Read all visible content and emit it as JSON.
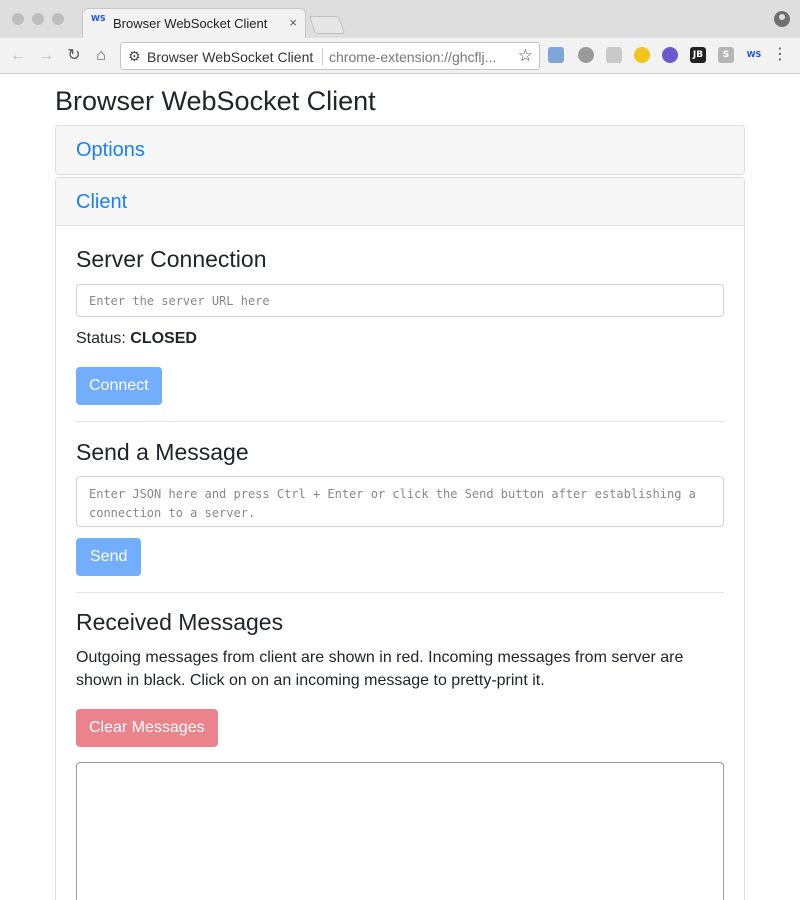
{
  "browser": {
    "tab_title": "Browser WebSocket Client",
    "tab_favicon_text": "WS",
    "close_glyph": "×",
    "omnibox_title": "Browser WebSocket Client",
    "omnibox_url": "chrome-extension://ghcflj...",
    "extension_labels": {
      "jb": "JB",
      "s": "S",
      "ws": "WS"
    }
  },
  "page": {
    "title": "Browser WebSocket Client",
    "options_header": "Options",
    "client_header": "Client"
  },
  "server_connection": {
    "heading": "Server Connection",
    "url_placeholder": "Enter the server URL here",
    "status_label": "Status:",
    "status_value": "CLOSED",
    "connect_label": "Connect"
  },
  "send_message": {
    "heading": "Send a Message",
    "placeholder": "Enter JSON here and press Ctrl + Enter or click the Send button after establishing a connection to a server.",
    "send_label": "Send"
  },
  "received_messages": {
    "heading": "Received Messages",
    "description": "Outgoing messages from client are shown in red. Incoming messages from server are shown in black. Click on on an incoming message to pretty-print it.",
    "clear_label": "Clear Messages"
  },
  "colors": {
    "link": "#1a7ef7",
    "primary_button": "#72aefc",
    "danger_button": "#ea838c"
  }
}
